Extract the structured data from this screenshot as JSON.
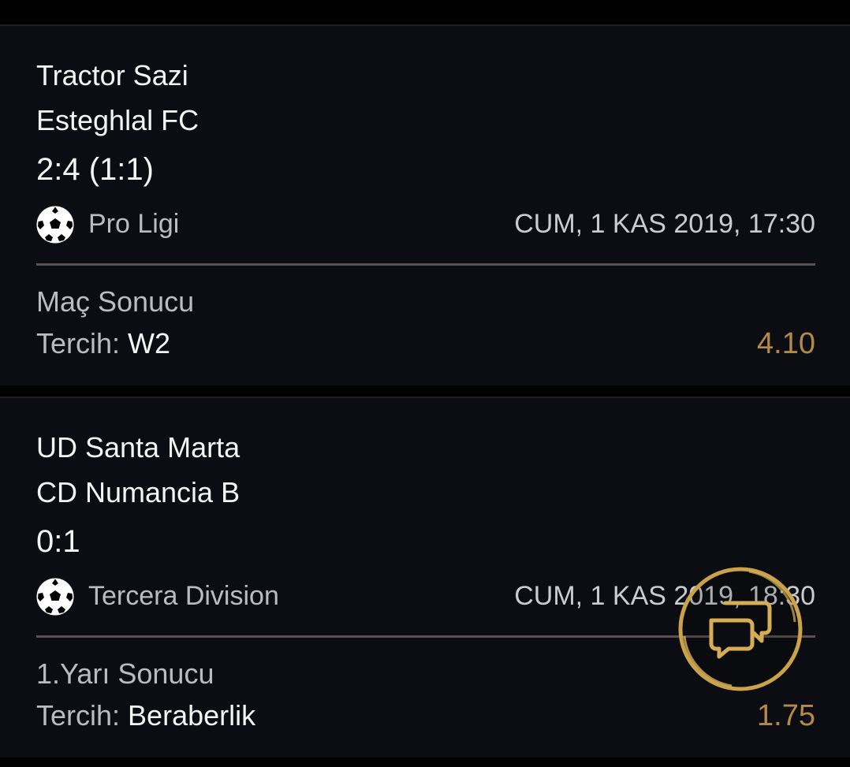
{
  "matches": [
    {
      "home_team": "Tractor Sazi",
      "away_team": "Esteghlal FC",
      "score": "2:4 (1:1)",
      "sport_icon": "soccer-ball-icon",
      "league": "Pro Ligi",
      "datetime": "CUM, 1 KAS 2019, 17:30",
      "market": "Maç Sonucu",
      "pick_label": "Tercih:",
      "pick_value": "W2",
      "odds": "4.10"
    },
    {
      "home_team": "UD Santa Marta",
      "away_team": "CD Numancia B",
      "score": "0:1",
      "sport_icon": "soccer-ball-icon",
      "league": "Tercera Division",
      "datetime": "CUM, 1 KAS 2019, 18:30",
      "market": "1.Yarı Sonucu",
      "pick_label": "Tercih:",
      "pick_value": "Beraberlik",
      "odds": "1.75"
    }
  ],
  "chat_button": {
    "icon": "chat-bubbles-icon"
  },
  "colors": {
    "background": "#000000",
    "card": "#0b0d12",
    "odds": "#b58a47",
    "accent_gold": "#c9a24a"
  }
}
